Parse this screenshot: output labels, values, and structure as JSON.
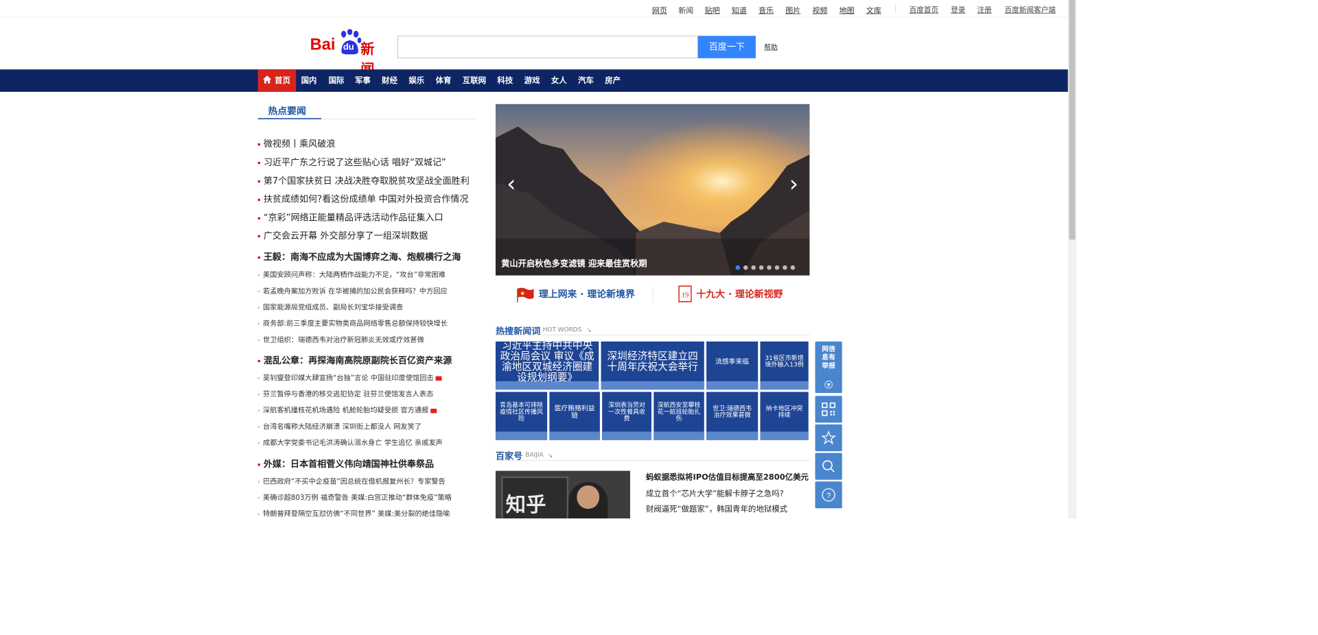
{
  "topnav": {
    "links": [
      "网页",
      "新闻",
      "贴吧",
      "知道",
      "音乐",
      "图片",
      "视频",
      "地图",
      "文库"
    ],
    "right": [
      "百度首页",
      "登录",
      "注册",
      "百度新闻客户端"
    ]
  },
  "logo": {
    "text": "Bai",
    "paw": "du",
    "suffix": "新闻"
  },
  "search": {
    "value": "",
    "button": "百度一下",
    "help": "帮助"
  },
  "nav": {
    "items": [
      "首页",
      "国内",
      "国际",
      "军事",
      "财经",
      "娱乐",
      "体育",
      "互联网",
      "科技",
      "游戏",
      "女人",
      "汽车",
      "房产"
    ]
  },
  "hot": {
    "title": "热点要闻",
    "items": [
      {
        "text": "微视频丨乘风破浪",
        "type": "big"
      },
      {
        "text": "习近平广东之行说了这些贴心话 唱好“双城记”",
        "type": "big"
      },
      {
        "text": "第7个国家扶贫日 决战决胜夺取脱贫攻坚战全面胜利",
        "type": "big"
      },
      {
        "text": "扶贫成绩如何?看这份成绩单  中国对外投资合作情况",
        "type": "big"
      },
      {
        "text": "“京彩”网络正能量精品评选活动作品征集入口",
        "type": "big"
      },
      {
        "text": "广交会云开幕 外交部分享了一组深圳数据",
        "type": "big"
      },
      {
        "text": "王毅：南海不应成为大国博弈之海、炮舰横行之海",
        "type": "bold"
      },
      {
        "text": "美国安顾问声称：大陆两栖作战能力不足，“攻台”非常困难",
        "type": "small"
      },
      {
        "text": "若孟晚舟案加方败诉 在华被捕的加公民会获释吗？中方回应",
        "type": "small"
      },
      {
        "text": "国家能源局党组成员、副局长刘宝华接受调查",
        "type": "small"
      },
      {
        "text": "商务部:前三季度主要实物类商品网络零售总额保持较快增长",
        "type": "small"
      },
      {
        "text": "世卫组织：瑞德西韦对治疗新冠肺炎无效或疗效甚微",
        "type": "small"
      },
      {
        "text": "混乱公章：再探海南高院原副院长百亿资产来源",
        "type": "bold"
      },
      {
        "text": "吴钊燮登印媒大肆宣扬“台独”言论 中国驻印度使馆回击",
        "type": "small",
        "video": true
      },
      {
        "text": "芬兰暂停与香港的移交逃犯协定 驻芬兰使馆发言人表态",
        "type": "small"
      },
      {
        "text": "深航客机撞枝花机场遇险 机舱轮胎均疑受损 官方通报",
        "type": "small",
        "video": true
      },
      {
        "text": "台湾名嘴称大陆经济崩溃 深圳街上都没人 网友笑了",
        "type": "small"
      },
      {
        "text": "成都大学党委书记毛洪涛确认溺水身亡 学生追忆 亲戚发声",
        "type": "small"
      },
      {
        "text": "外媒：日本首相菅义伟向靖国神社供奉祭品",
        "type": "bold"
      },
      {
        "text": "巴西政府“不买中企疫苗”因总统在借机报复州长？专家警告",
        "type": "small"
      },
      {
        "text": "美确诊超803万例 福奇警告 美媒:白宫正推动“群体免疫”策略",
        "type": "small"
      },
      {
        "text": "特朗普拜登隔空互怼仿佛“不同世界” 美媒:美分裂的绝佳隐喻",
        "type": "small"
      }
    ]
  },
  "slideshow": {
    "caption": "黄山开启秋色多变滤镜 迎来最佳赏秋期",
    "active_index": 0,
    "count": 8
  },
  "banners": {
    "left": "理上网来 · 理论新境界",
    "right": "十九大 · 理论新视野"
  },
  "hotwords": {
    "title": "热搜新闻词",
    "subtitle": "HOT WORDS",
    "tiles": [
      "习近平主持中共中央政治局会议 审议《成渝地区双城经济圈建设规划纲要》",
      "深圳经济特区建立四十周年庆祝大会举行",
      "流感季来临",
      "31省区市新增境外输入13例",
      "青岛基本可排除疫情社区传播风险",
      "医疗贿赂利益链",
      "深圳表当劳对一次性餐具收费",
      "深航西安至攀枝花一航班轮胎扎伤",
      "世卫:瑞德西韦治疗效果甚微",
      "纳卡地区冲突持续"
    ]
  },
  "baijia": {
    "title": "百家号",
    "subtitle": "BAIJIA",
    "image_text": "知乎",
    "items": [
      "蚂蚁据悉拟将IPO估值目标提高至2800亿美元",
      "成立首个“芯片大学”能解卡脖子之急吗?",
      "财阀逼死“做题家”，韩国青年的地狱模式"
    ]
  },
  "side": {
    "report": "网信息有举报"
  },
  "colors": {
    "nav_bg": "#0e2563",
    "home_bg": "#d9241c",
    "accent": "#3385ff",
    "tile": "#1e4594",
    "side": "#4a86ce"
  }
}
